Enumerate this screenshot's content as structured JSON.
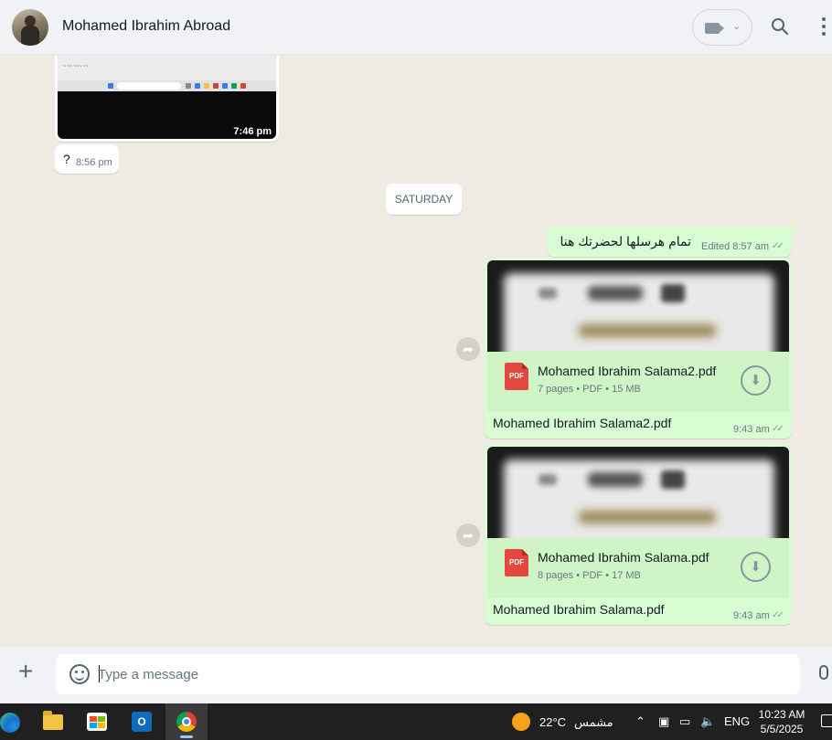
{
  "header": {
    "contact_name": "Mohamed Ibrahim Abroad"
  },
  "messages": {
    "image_time": "7:46 pm",
    "question_text": "?",
    "question_time": "8:56 pm",
    "day_divider": "SATURDAY",
    "arabic_text": "تمام هرسلها لحضرتك هنا",
    "arabic_meta": "Edited 8:57 am",
    "docs": [
      {
        "file_name": "Mohamed Ibrahim Salama2.pdf",
        "info": "7 pages • PDF • 15 MB",
        "caption": "Mohamed Ibrahim Salama2.pdf",
        "time": "9:43 am"
      },
      {
        "file_name": "Mohamed Ibrahim Salama.pdf",
        "info": "8 pages • PDF • 17 MB",
        "caption": "Mohamed Ibrahim Salama.pdf",
        "time": "9:43 am"
      }
    ],
    "pdf_badge": "PDF"
  },
  "composer": {
    "placeholder": "Type a message",
    "value": ""
  },
  "taskbar": {
    "temperature": "22°C",
    "weather": "مشمس",
    "language": "ENG",
    "time": "10:23 AM",
    "date": "5/5/2025",
    "outlook_letter": "O"
  },
  "icons": {
    "header": [
      "video-call-icon",
      "chevron-down-icon",
      "search-icon",
      "menu-icon"
    ],
    "composer": [
      "plus-icon",
      "sticker-icon",
      "mic-icon"
    ],
    "chat": [
      "forward-icon",
      "pdf-icon",
      "download-icon",
      "double-check-icon"
    ]
  },
  "colors": {
    "outgoing_bubble": "#d9fdd3",
    "incoming_bubble": "#ffffff",
    "chat_background": "#efeae2",
    "pdf_red": "#e4473f"
  }
}
